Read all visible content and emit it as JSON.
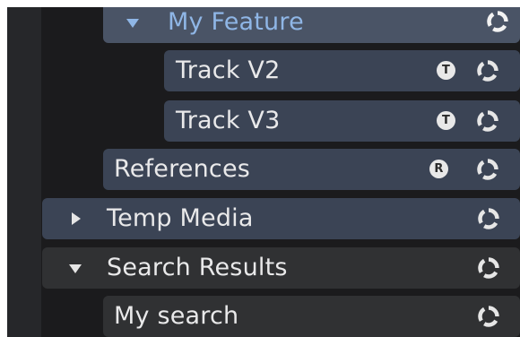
{
  "tree": {
    "my_feature": {
      "label": "My Feature",
      "icon": "chevron-down-icon"
    },
    "track_v2": {
      "label": "Track V2",
      "badge": "T"
    },
    "track_v3": {
      "label": "Track V3",
      "badge": "T"
    },
    "references": {
      "label": "References",
      "badge": "R"
    },
    "temp_media": {
      "label": "Temp Media",
      "icon": "chevron-right-icon"
    },
    "search_results": {
      "label": "Search Results",
      "icon": "chevron-down-icon"
    },
    "my_search": {
      "label": "My search"
    }
  },
  "colors": {
    "background": "#1b1b1d",
    "row_blue": "#3b4455",
    "row_blue_light": "#4a5466",
    "row_dark": "#303133",
    "selected_text": "#8fb6e6",
    "text": "#e9e9ea"
  }
}
